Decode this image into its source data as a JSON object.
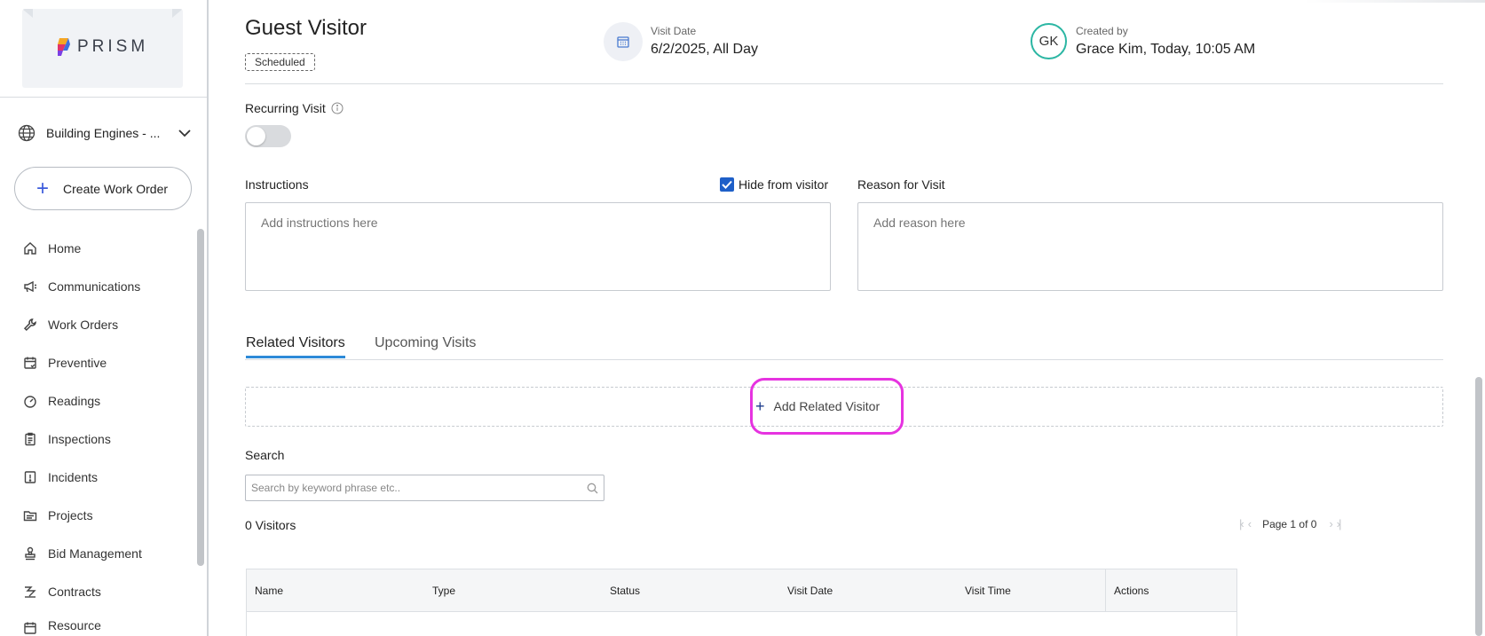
{
  "sidebar": {
    "logo_text": "PRISM",
    "org_name": "Building Engines - ...",
    "create_label": "Create Work Order",
    "items": [
      {
        "label": "Home",
        "icon": "home-icon"
      },
      {
        "label": "Communications",
        "icon": "megaphone-icon"
      },
      {
        "label": "Work Orders",
        "icon": "wrench-icon"
      },
      {
        "label": "Preventive",
        "icon": "calendar-check-icon"
      },
      {
        "label": "Readings",
        "icon": "gauge-icon"
      },
      {
        "label": "Inspections",
        "icon": "clipboard-icon"
      },
      {
        "label": "Incidents",
        "icon": "alert-icon"
      },
      {
        "label": "Projects",
        "icon": "folder-icon"
      },
      {
        "label": "Bid Management",
        "icon": "stamp-icon"
      },
      {
        "label": "Contracts",
        "icon": "signature-icon"
      },
      {
        "label": "Resource",
        "icon": "calendar-icon"
      }
    ]
  },
  "header": {
    "title": "Guest Visitor",
    "status": "Scheduled",
    "visit_date_label": "Visit Date",
    "visit_date_value": "6/2/2025, All Day",
    "created_by_label": "Created by",
    "created_by_value": "Grace Kim, Today, 10:05 AM",
    "avatar_initials": "GK"
  },
  "form": {
    "recurring_label": "Recurring Visit",
    "recurring_on": false,
    "instructions_label": "Instructions",
    "hide_from_visitor_label": "Hide from visitor",
    "hide_from_visitor_checked": true,
    "instructions_placeholder": "Add instructions here",
    "reason_label": "Reason for Visit",
    "reason_placeholder": "Add reason here"
  },
  "tabs": [
    {
      "label": "Related Visitors",
      "active": true
    },
    {
      "label": "Upcoming Visits",
      "active": false
    }
  ],
  "related": {
    "add_label": "Add Related Visitor",
    "search_label": "Search",
    "search_placeholder": "Search by keyword phrase etc..",
    "count_label": "0 Visitors",
    "page_label": "Page 1 of 0",
    "columns": [
      "Name",
      "Type",
      "Status",
      "Visit Date",
      "Visit Time",
      "Actions"
    ]
  },
  "colors": {
    "accent": "#2d8ad8",
    "highlight": "#e633e0",
    "avatar_ring": "#2bb6a3",
    "checkbox": "#1e5fc8"
  }
}
